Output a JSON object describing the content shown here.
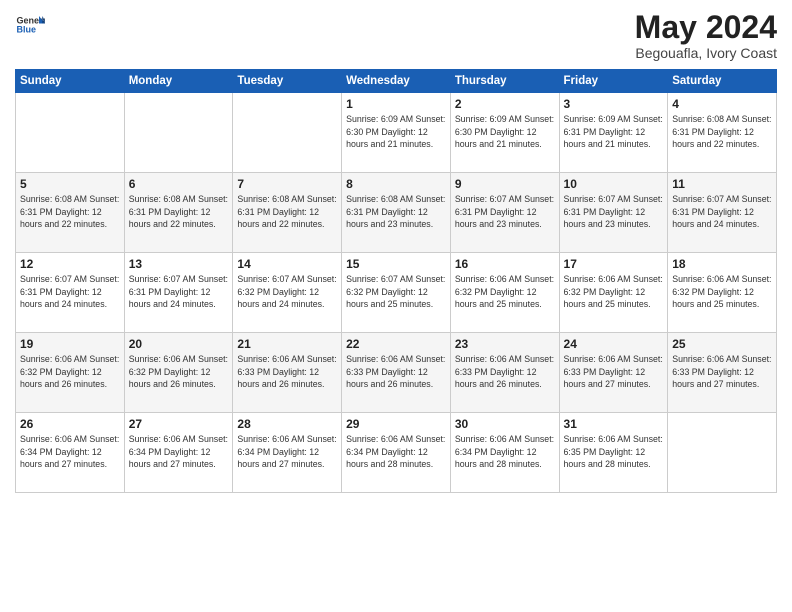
{
  "logo": {
    "general": "General",
    "blue": "Blue"
  },
  "header": {
    "month": "May 2024",
    "location": "Begouafla, Ivory Coast"
  },
  "days_of_week": [
    "Sunday",
    "Monday",
    "Tuesday",
    "Wednesday",
    "Thursday",
    "Friday",
    "Saturday"
  ],
  "weeks": [
    [
      {
        "day": "",
        "content": ""
      },
      {
        "day": "",
        "content": ""
      },
      {
        "day": "",
        "content": ""
      },
      {
        "day": "1",
        "content": "Sunrise: 6:09 AM\nSunset: 6:30 PM\nDaylight: 12 hours\nand 21 minutes."
      },
      {
        "day": "2",
        "content": "Sunrise: 6:09 AM\nSunset: 6:30 PM\nDaylight: 12 hours\nand 21 minutes."
      },
      {
        "day": "3",
        "content": "Sunrise: 6:09 AM\nSunset: 6:31 PM\nDaylight: 12 hours\nand 21 minutes."
      },
      {
        "day": "4",
        "content": "Sunrise: 6:08 AM\nSunset: 6:31 PM\nDaylight: 12 hours\nand 22 minutes."
      }
    ],
    [
      {
        "day": "5",
        "content": "Sunrise: 6:08 AM\nSunset: 6:31 PM\nDaylight: 12 hours\nand 22 minutes."
      },
      {
        "day": "6",
        "content": "Sunrise: 6:08 AM\nSunset: 6:31 PM\nDaylight: 12 hours\nand 22 minutes."
      },
      {
        "day": "7",
        "content": "Sunrise: 6:08 AM\nSunset: 6:31 PM\nDaylight: 12 hours\nand 22 minutes."
      },
      {
        "day": "8",
        "content": "Sunrise: 6:08 AM\nSunset: 6:31 PM\nDaylight: 12 hours\nand 23 minutes."
      },
      {
        "day": "9",
        "content": "Sunrise: 6:07 AM\nSunset: 6:31 PM\nDaylight: 12 hours\nand 23 minutes."
      },
      {
        "day": "10",
        "content": "Sunrise: 6:07 AM\nSunset: 6:31 PM\nDaylight: 12 hours\nand 23 minutes."
      },
      {
        "day": "11",
        "content": "Sunrise: 6:07 AM\nSunset: 6:31 PM\nDaylight: 12 hours\nand 24 minutes."
      }
    ],
    [
      {
        "day": "12",
        "content": "Sunrise: 6:07 AM\nSunset: 6:31 PM\nDaylight: 12 hours\nand 24 minutes."
      },
      {
        "day": "13",
        "content": "Sunrise: 6:07 AM\nSunset: 6:31 PM\nDaylight: 12 hours\nand 24 minutes."
      },
      {
        "day": "14",
        "content": "Sunrise: 6:07 AM\nSunset: 6:32 PM\nDaylight: 12 hours\nand 24 minutes."
      },
      {
        "day": "15",
        "content": "Sunrise: 6:07 AM\nSunset: 6:32 PM\nDaylight: 12 hours\nand 25 minutes."
      },
      {
        "day": "16",
        "content": "Sunrise: 6:06 AM\nSunset: 6:32 PM\nDaylight: 12 hours\nand 25 minutes."
      },
      {
        "day": "17",
        "content": "Sunrise: 6:06 AM\nSunset: 6:32 PM\nDaylight: 12 hours\nand 25 minutes."
      },
      {
        "day": "18",
        "content": "Sunrise: 6:06 AM\nSunset: 6:32 PM\nDaylight: 12 hours\nand 25 minutes."
      }
    ],
    [
      {
        "day": "19",
        "content": "Sunrise: 6:06 AM\nSunset: 6:32 PM\nDaylight: 12 hours\nand 26 minutes."
      },
      {
        "day": "20",
        "content": "Sunrise: 6:06 AM\nSunset: 6:32 PM\nDaylight: 12 hours\nand 26 minutes."
      },
      {
        "day": "21",
        "content": "Sunrise: 6:06 AM\nSunset: 6:33 PM\nDaylight: 12 hours\nand 26 minutes."
      },
      {
        "day": "22",
        "content": "Sunrise: 6:06 AM\nSunset: 6:33 PM\nDaylight: 12 hours\nand 26 minutes."
      },
      {
        "day": "23",
        "content": "Sunrise: 6:06 AM\nSunset: 6:33 PM\nDaylight: 12 hours\nand 26 minutes."
      },
      {
        "day": "24",
        "content": "Sunrise: 6:06 AM\nSunset: 6:33 PM\nDaylight: 12 hours\nand 27 minutes."
      },
      {
        "day": "25",
        "content": "Sunrise: 6:06 AM\nSunset: 6:33 PM\nDaylight: 12 hours\nand 27 minutes."
      }
    ],
    [
      {
        "day": "26",
        "content": "Sunrise: 6:06 AM\nSunset: 6:34 PM\nDaylight: 12 hours\nand 27 minutes."
      },
      {
        "day": "27",
        "content": "Sunrise: 6:06 AM\nSunset: 6:34 PM\nDaylight: 12 hours\nand 27 minutes."
      },
      {
        "day": "28",
        "content": "Sunrise: 6:06 AM\nSunset: 6:34 PM\nDaylight: 12 hours\nand 27 minutes."
      },
      {
        "day": "29",
        "content": "Sunrise: 6:06 AM\nSunset: 6:34 PM\nDaylight: 12 hours\nand 28 minutes."
      },
      {
        "day": "30",
        "content": "Sunrise: 6:06 AM\nSunset: 6:34 PM\nDaylight: 12 hours\nand 28 minutes."
      },
      {
        "day": "31",
        "content": "Sunrise: 6:06 AM\nSunset: 6:35 PM\nDaylight: 12 hours\nand 28 minutes."
      },
      {
        "day": "",
        "content": ""
      }
    ]
  ]
}
